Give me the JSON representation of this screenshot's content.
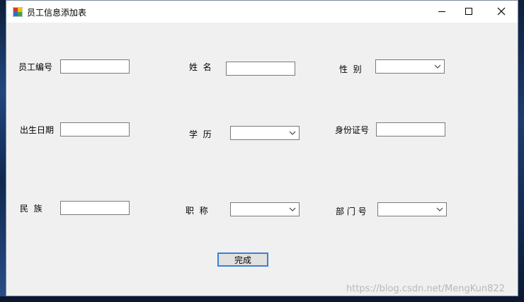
{
  "window": {
    "title": "员工信息添加表",
    "controls": {
      "minimize_icon": "minimize-icon",
      "maximize_icon": "maximize-icon",
      "close_icon": "close-icon"
    }
  },
  "form": {
    "employee_id_label": "员工编号",
    "name_label": "姓  名",
    "gender_label": "性  别",
    "birth_date_label": "出生日期",
    "education_label": "学  历",
    "id_number_label": "身份证号",
    "ethnicity_label": "民  族",
    "title_label": "职  称",
    "department_label": "部 门 号",
    "employee_id_value": "",
    "name_value": "",
    "gender_value": "",
    "birth_date_value": "",
    "education_value": "",
    "id_number_value": "",
    "ethnicity_value": "",
    "title_value": "",
    "department_value": ""
  },
  "actions": {
    "done_label": "完成"
  },
  "watermark": "https://blog.csdn.net/MengKun822",
  "colors": {
    "accent": "#3c7fd6",
    "window_bg": "#f0f0f0",
    "titlebar_bg": "#ffffff"
  }
}
